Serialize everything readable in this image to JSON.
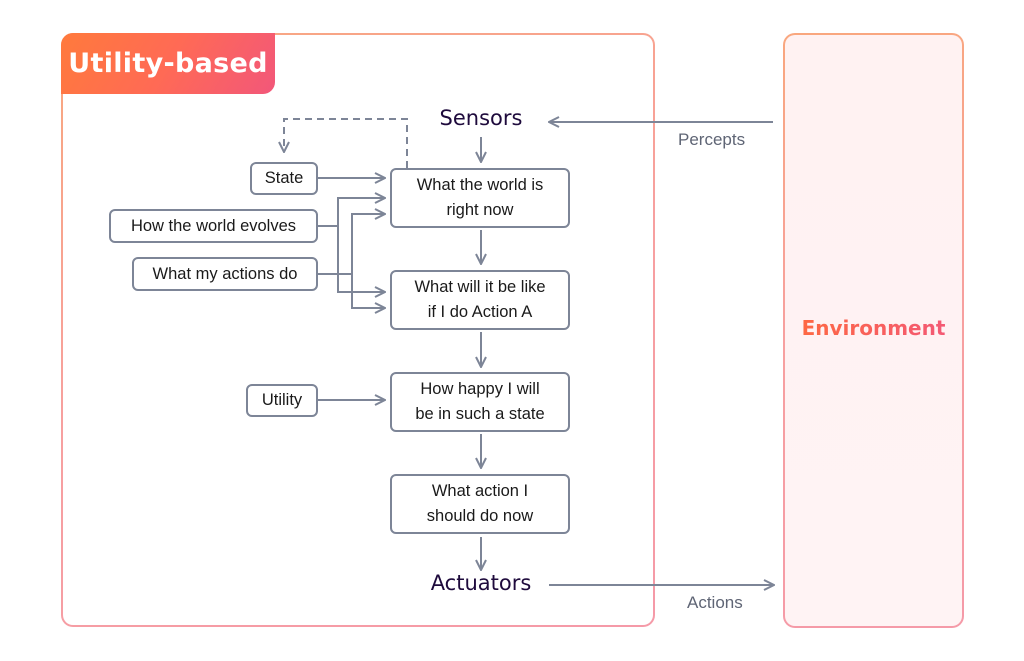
{
  "agent": {
    "title": "Utility-based",
    "sensors": "Sensors",
    "actuators": "Actuators",
    "nodes": {
      "state": "State",
      "world_evolves": "How the world evolves",
      "actions_do": "What my actions do",
      "utility": "Utility",
      "world_now": [
        "What the world is",
        "right now"
      ],
      "action_a": [
        "What will it be like",
        "if I do Action A"
      ],
      "happy": [
        "How happy I will",
        "be in such a state"
      ],
      "action_now": [
        "What action I",
        "should do now"
      ]
    }
  },
  "environment": {
    "label": "Environment"
  },
  "edges": {
    "percepts": "Percepts",
    "actions": "Actions"
  },
  "colors": {
    "accent_orange": "#ff7a3c",
    "accent_pink": "#f2577a",
    "wire": "#7d8597",
    "heading": "#1e0a3c",
    "env_fill": "#fff2f2"
  }
}
